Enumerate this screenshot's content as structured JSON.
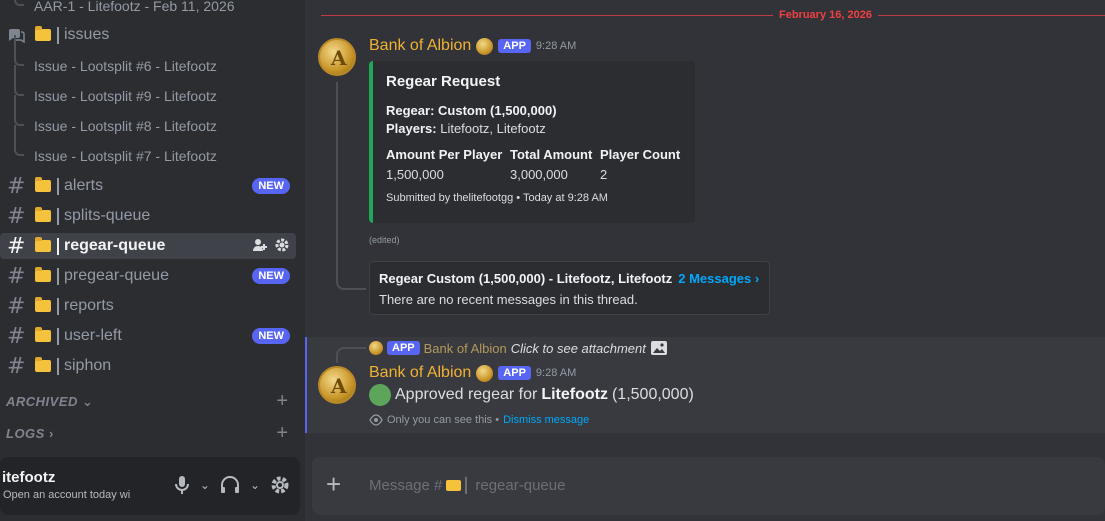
{
  "sidebar": {
    "top_thread": "AAR-1 - Litefootz - Feb 11, 2026",
    "forum_channel": "issues",
    "threads": [
      "Issue - Lootsplit #6 - Litefootz",
      "Issue - Lootsplit #9 - Litefootz",
      "Issue - Lootsplit #8 - Litefootz",
      "Issue - Lootsplit #7 - Litefootz"
    ],
    "channels": [
      {
        "name": "alerts",
        "badge": "NEW"
      },
      {
        "name": "splits-queue",
        "badge": ""
      },
      {
        "name": "regear-queue",
        "badge": ""
      },
      {
        "name": "pregear-queue",
        "badge": "NEW"
      },
      {
        "name": "reports",
        "badge": ""
      },
      {
        "name": "user-left",
        "badge": "NEW"
      },
      {
        "name": "siphon",
        "badge": ""
      }
    ],
    "categories": [
      "ARCHIVED",
      "LOGS"
    ]
  },
  "user": {
    "name": "itefootz",
    "status": "Open an account today wi"
  },
  "chat": {
    "date_divider": "February 16, 2026",
    "msg1": {
      "author": "Bank of Albion",
      "badge": "APP",
      "time": "9:28 AM",
      "embed": {
        "title": "Regear Request",
        "regear_label": "Regear:",
        "regear_value": "Custom (1,500,000)",
        "players_label": "Players:",
        "players_value": "Litefootz, Litefootz",
        "fields": [
          {
            "name": "Amount Per Player",
            "value": "1,500,000"
          },
          {
            "name": "Total Amount",
            "value": "3,000,000"
          },
          {
            "name": "Player Count",
            "value": "2"
          }
        ],
        "footer": "Submitted by thelitefootgg • Today at 9:28 AM"
      },
      "edited": "(edited)",
      "thread": {
        "title": "Regear Custom (1,500,000) - Litefootz, Litefootz",
        "count": "2 Messages ›",
        "subtitle": "There are no recent messages in this thread."
      }
    },
    "msg2": {
      "reply_badge": "APP",
      "reply_author": "Bank of Albion",
      "reply_text": "Click to see attachment",
      "author": "Bank of Albion",
      "badge": "APP",
      "time": "9:28 AM",
      "text_pre": "Approved regear for",
      "text_bold": "Litefootz",
      "text_post": "(1,500,000)",
      "ephemeral": "Only you can see this •",
      "dismiss": "Dismiss message"
    }
  },
  "composer": {
    "placeholder_prefix": "Message #",
    "channel": "regear-queue"
  },
  "colors": {
    "accent": "#5865f2",
    "author": "#f0b232",
    "embed_bar": "#23a55a",
    "divider": "#f23f43",
    "link": "#00a8fc"
  }
}
